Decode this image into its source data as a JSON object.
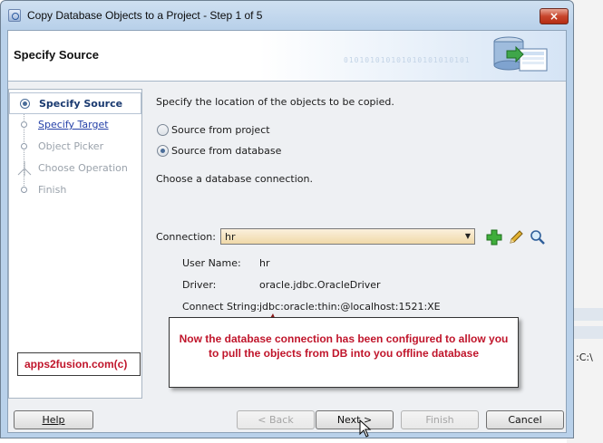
{
  "window": {
    "title": "Copy Database Objects to a Project - Step 1 of 5",
    "close_glyph": "×"
  },
  "header": {
    "title": "Specify Source",
    "binary_text": "010101010101010101010101"
  },
  "nav": {
    "items": [
      {
        "label": "Specify Source",
        "state": "active"
      },
      {
        "label": "Specify Target",
        "state": "link"
      },
      {
        "label": "Object Picker",
        "state": "disabled"
      },
      {
        "label": "Choose Operation",
        "state": "disabled"
      },
      {
        "label": "Finish",
        "state": "disabled"
      }
    ]
  },
  "watermark": "apps2fusion.com(c)",
  "content": {
    "intro": "Specify the location of the objects to be copied.",
    "radio_project": "Source from project",
    "radio_database": "Source from database",
    "selected_source": "database",
    "choose_conn": "Choose a database connection.",
    "connection_label": "Connection:",
    "connection_value": "hr",
    "details": [
      {
        "label": "User Name:",
        "value": "hr"
      },
      {
        "label": "Driver:",
        "value": "oracle.jdbc.OracleDriver"
      },
      {
        "label": "Connect String:",
        "value": "jdbc:oracle:thin:@localhost:1521:XE"
      }
    ]
  },
  "callout": {
    "text": "Now the database connection has been configured to allow you to pull the objects from DB into you offline database"
  },
  "buttons": {
    "help": "Help",
    "back": "< Back",
    "next": "Next >",
    "finish": "Finish",
    "cancel": "Cancel"
  },
  "background_fragment": ":C:\\",
  "colors": {
    "accent_red": "#c0152b",
    "nav_active": "#1a3a70",
    "link_blue": "#2541a8"
  }
}
